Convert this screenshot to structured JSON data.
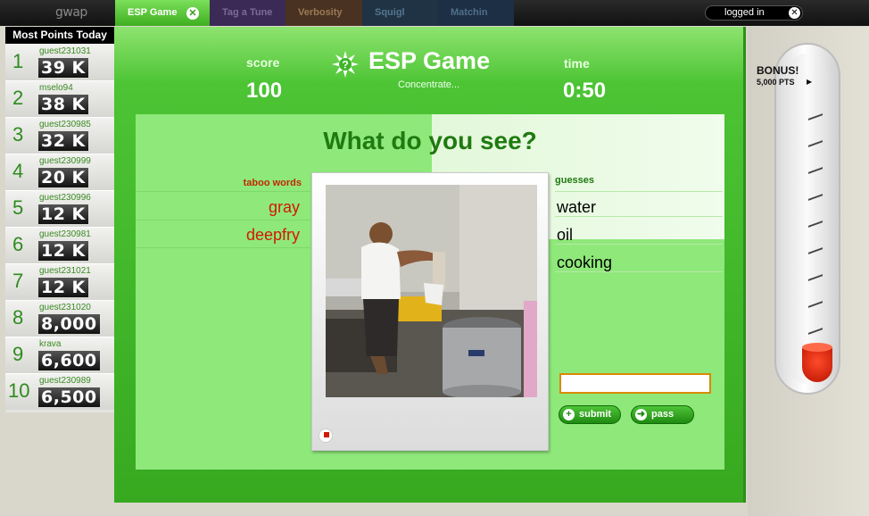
{
  "topbar": {
    "logo": "gwap",
    "tabs": [
      {
        "label": "ESP Game",
        "active": true,
        "close": "✕"
      },
      {
        "label": "Tag a Tune"
      },
      {
        "label": "Verbosity"
      },
      {
        "label": "Squigl"
      },
      {
        "label": "Matchin"
      }
    ],
    "login_label": "logged in",
    "login_close": "✕"
  },
  "leaderboard": {
    "title": "Most Points Today",
    "rows": [
      {
        "rank": "1",
        "name": "guest231031",
        "score": "39 K"
      },
      {
        "rank": "2",
        "name": "mselo94",
        "score": "38 K"
      },
      {
        "rank": "3",
        "name": "guest230985",
        "score": "32 K"
      },
      {
        "rank": "4",
        "name": "guest230999",
        "score": "20 K"
      },
      {
        "rank": "5",
        "name": "guest230996",
        "score": "12 K"
      },
      {
        "rank": "6",
        "name": "guest230981",
        "score": "12 K"
      },
      {
        "rank": "7",
        "name": "guest231021",
        "score": "12 K"
      },
      {
        "rank": "8",
        "name": "guest231020",
        "score": "8,000"
      },
      {
        "rank": "9",
        "name": "krava",
        "score": "6,600"
      },
      {
        "rank": "10",
        "name": "guest230989",
        "score": "6,500"
      }
    ]
  },
  "game": {
    "title": "ESP Game",
    "subtitle": "Concentrate...",
    "score_label": "score",
    "score_value": "100",
    "time_label": "time",
    "time_value": "0:50",
    "question": "What do you see?",
    "taboo_label": "taboo words",
    "taboo": [
      "gray",
      "deepfry"
    ],
    "guesses_label": "guesses",
    "guesses": [
      "water",
      "oil",
      "cooking"
    ],
    "input_value": "",
    "submit_label": "submit",
    "pass_label": "pass",
    "submit_icon": "plus-icon",
    "pass_icon": "arrow-right-icon"
  },
  "bonus": {
    "label": "BONUS!",
    "points": "5,000 PTS",
    "level": 0.1
  },
  "colors": {
    "accent": "#37a920",
    "taboo": "#d01a00",
    "leader_rank": "#2e8b1e"
  }
}
